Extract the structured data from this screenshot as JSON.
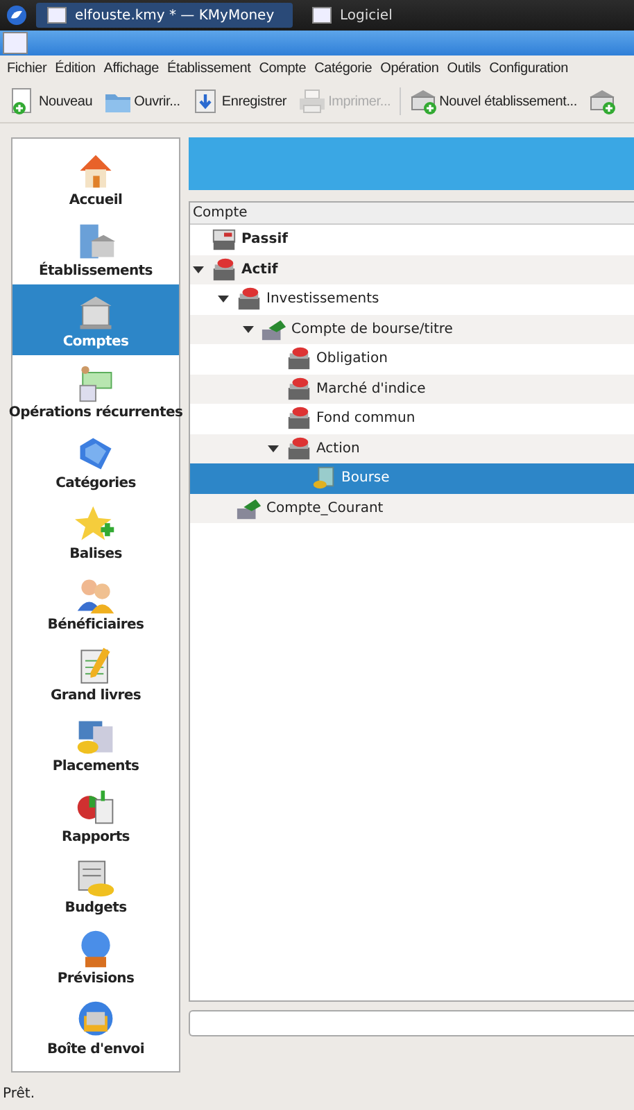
{
  "taskbar": {
    "tasks": [
      {
        "label": "elfouste.kmy * — KMyMoney",
        "selected": true
      },
      {
        "label": "Logiciel",
        "selected": false
      }
    ]
  },
  "menu": [
    "Fichier",
    "Édition",
    "Affichage",
    "Établissement",
    "Compte",
    "Catégorie",
    "Opération",
    "Outils",
    "Configuration"
  ],
  "toolbar": [
    {
      "label": "Nouveau",
      "kind": "new",
      "disabled": false
    },
    {
      "label": "Ouvrir...",
      "kind": "open",
      "disabled": false
    },
    {
      "label": "Enregistrer",
      "kind": "save",
      "disabled": false
    },
    {
      "label": "Imprimer...",
      "kind": "print",
      "disabled": true
    },
    {
      "label": "Nouvel établissement...",
      "kind": "institution",
      "disabled": false
    },
    {
      "kind": "institution"
    }
  ],
  "sidebar": {
    "items": [
      {
        "label": "Accueil",
        "kind": "home",
        "selected": false
      },
      {
        "label": "Établissements",
        "kind": "institutions",
        "selected": false
      },
      {
        "label": "Comptes",
        "kind": "accounts",
        "selected": true
      },
      {
        "label": "Opérations récurrentes",
        "kind": "schedule",
        "selected": false
      },
      {
        "label": "Catégories",
        "kind": "categories",
        "selected": false
      },
      {
        "label": "Balises",
        "kind": "tags",
        "selected": false
      },
      {
        "label": "Bénéficiaires",
        "kind": "payees",
        "selected": false
      },
      {
        "label": "Grand livres",
        "kind": "ledgers",
        "selected": false
      },
      {
        "label": "Placements",
        "kind": "investments",
        "selected": false
      },
      {
        "label": "Rapports",
        "kind": "reports",
        "selected": false
      },
      {
        "label": "Budgets",
        "kind": "budgets",
        "selected": false
      },
      {
        "label": "Prévisions",
        "kind": "forecast",
        "selected": false
      },
      {
        "label": "Boîte d'envoi",
        "kind": "outbox",
        "selected": false
      }
    ]
  },
  "tree": {
    "columns": [
      "Compte"
    ],
    "rows": [
      {
        "label": "Passif",
        "kind": "liability",
        "bold": true,
        "selected": false,
        "expanded": false
      },
      {
        "label": "Actif",
        "kind": "asset",
        "bold": true,
        "selected": false,
        "expanded": true,
        "children": [
          {
            "label": "Investissements",
            "kind": "asset",
            "bold": false,
            "selected": false,
            "expanded": true,
            "children": [
              {
                "label": "Compte de bourse/titre",
                "kind": "broker",
                "bold": false,
                "selected": false,
                "expanded": true,
                "children": [
                  {
                    "label": "Obligation",
                    "kind": "asset",
                    "bold": false,
                    "selected": false,
                    "expanded": false
                  },
                  {
                    "label": "Marché d'indice",
                    "kind": "asset",
                    "bold": false,
                    "selected": false,
                    "expanded": false
                  },
                  {
                    "label": "Fond commun",
                    "kind": "asset",
                    "bold": false,
                    "selected": false,
                    "expanded": false
                  },
                  {
                    "label": "Action",
                    "kind": "asset",
                    "bold": false,
                    "selected": false,
                    "expanded": true,
                    "children": [
                      {
                        "label": "Bourse",
                        "kind": "stock",
                        "bold": false,
                        "selected": true,
                        "expanded": false
                      }
                    ]
                  }
                ]
              }
            ]
          },
          {
            "label": "Compte_Courant",
            "kind": "broker",
            "bold": false,
            "selected": false,
            "expanded": false
          }
        ]
      }
    ]
  },
  "status_bar": "Prêt."
}
